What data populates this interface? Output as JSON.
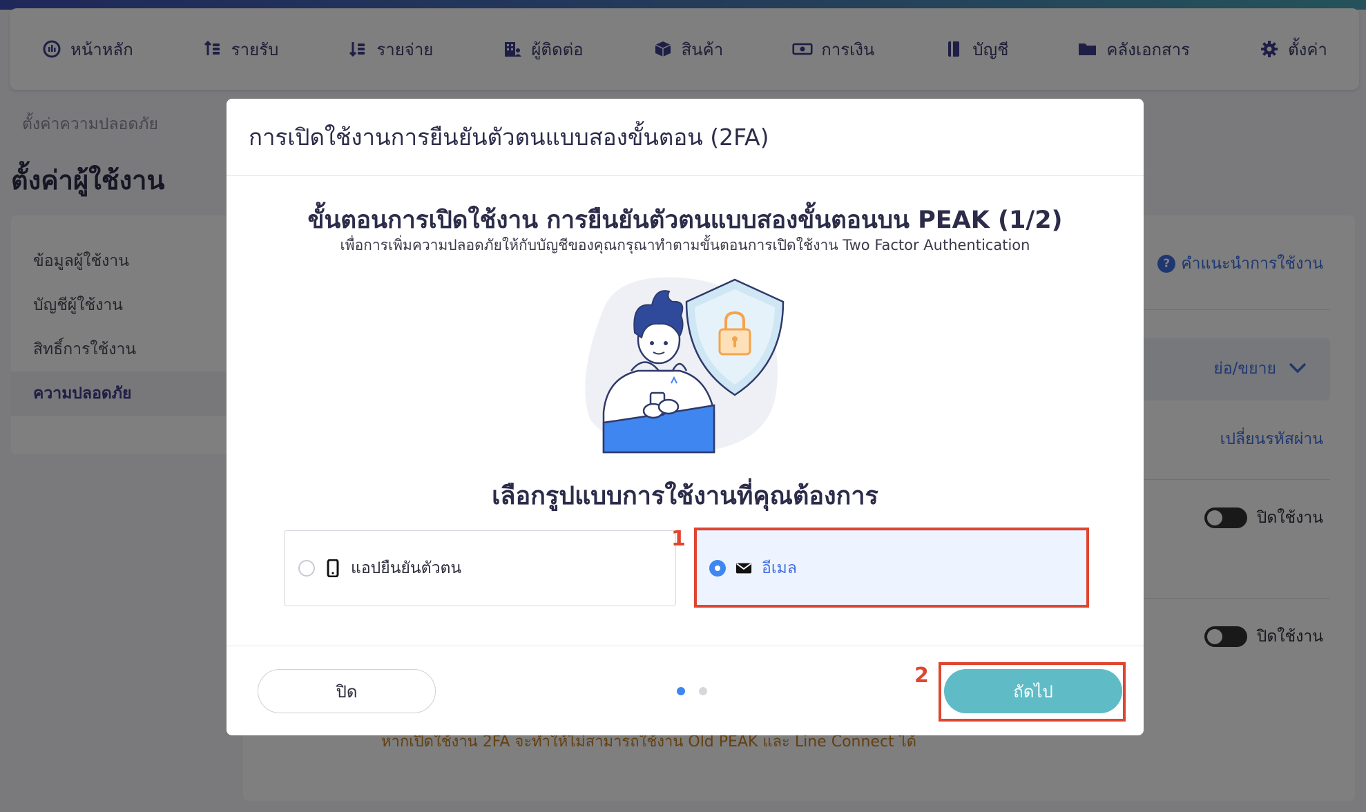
{
  "nav": {
    "items": [
      {
        "label": "หน้าหลัก",
        "icon": "dashboard-icon"
      },
      {
        "label": "รายรับ",
        "icon": "income-icon"
      },
      {
        "label": "รายจ่าย",
        "icon": "expense-icon"
      },
      {
        "label": "ผู้ติดต่อ",
        "icon": "contacts-icon"
      },
      {
        "label": "สินค้า",
        "icon": "product-icon"
      },
      {
        "label": "การเงิน",
        "icon": "money-icon"
      },
      {
        "label": "บัญชี",
        "icon": "ledger-icon"
      },
      {
        "label": "คลังเอกสาร",
        "icon": "folder-icon"
      },
      {
        "label": "ตั้งค่า",
        "icon": "gear-icon"
      }
    ]
  },
  "page": {
    "breadcrumb": "ตั้งค่าความปลอดภัย",
    "title": "ตั้งค่าผู้ใช้งาน"
  },
  "sidebar": {
    "items": [
      {
        "label": "ข้อมูลผู้ใช้งาน"
      },
      {
        "label": "บัญชีผู้ใช้งาน"
      },
      {
        "label": "สิทธิ์การใช้งาน"
      },
      {
        "label": "ความปลอดภัย"
      }
    ]
  },
  "main": {
    "help_link": "คำแนะนำการใช้งาน",
    "collapse_label": "ย่อ/ขยาย",
    "change_password": "เปลี่ยนรหัสผ่าน",
    "toggle1_label": "ปิดใช้งาน",
    "toggle2_label": "ปิดใช้งาน",
    "warning_text": "หากเปิดใช้งาน 2FA จะทำให้ไม่สามารถใช้งาน Old PEAK และ Line Connect ได้"
  },
  "modal": {
    "title": "การเปิดใช้งานการยืนยันตัวตนแบบสองขั้นตอน (2FA)",
    "step_title": "ขั้นตอนการเปิดใช้งาน การยืนยันตัวตนแบบสองขั้นตอนบน PEAK (1/2)",
    "step_subtitle": "เพื่อการเพิ่มความปลอดภัยให้กับบัญชีของคุณกรุณาทำตามขั้นตอนการเปิดใช้งาน Two Factor Authentication",
    "choose_title": "เลือกรูปแบบการใช้งานที่คุณต้องการ",
    "options": [
      {
        "label": "แอปยืนยันตัวตน",
        "icon": "phone-icon",
        "selected": false
      },
      {
        "label": "อีเมล",
        "icon": "envelope-icon",
        "selected": true
      }
    ],
    "close_button": "ปิด",
    "next_button": "ถัดไป",
    "page_indicator": {
      "current": 1,
      "total": 2
    }
  },
  "annotations": {
    "marker1": "1",
    "marker2": "2",
    "color": "#e0452f"
  },
  "colors": {
    "accent": "#3f6fe0",
    "next_button": "#5fbcc7",
    "selected_option_bg": "#eef4ff"
  }
}
